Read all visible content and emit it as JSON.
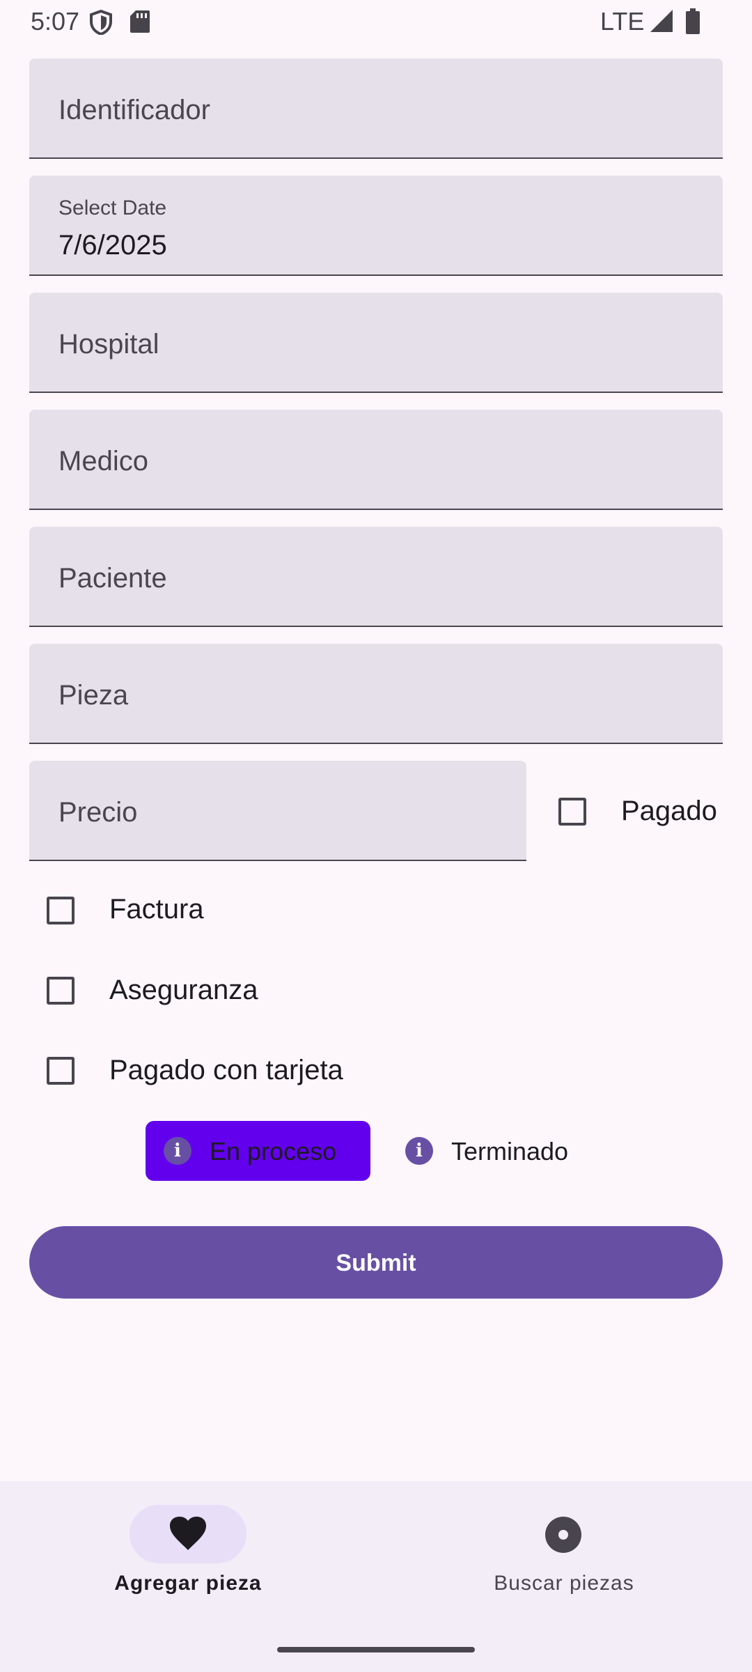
{
  "status_bar": {
    "time": "5:07",
    "network": "LTE",
    "icons": [
      "shield-icon",
      "sd-card-icon",
      "signal-icon",
      "battery-icon"
    ]
  },
  "form": {
    "identificador": {
      "placeholder": "Identificador"
    },
    "date": {
      "label": "Select Date",
      "value": "7/6/2025"
    },
    "hospital": {
      "placeholder": "Hospital"
    },
    "medico": {
      "placeholder": "Medico"
    },
    "paciente": {
      "placeholder": "Paciente"
    },
    "pieza": {
      "placeholder": "Pieza"
    },
    "precio": {
      "placeholder": "Precio"
    }
  },
  "checkboxes": {
    "pagado": {
      "label": "Pagado",
      "checked": false
    },
    "factura": {
      "label": "Factura",
      "checked": false
    },
    "aseguranza": {
      "label": "Aseguranza",
      "checked": false
    },
    "pagado_tarjeta": {
      "label": "Pagado con tarjeta",
      "checked": false
    }
  },
  "status_options": [
    {
      "label": "En proceso",
      "selected": true,
      "icon": "info-icon"
    },
    {
      "label": "Terminado",
      "selected": false,
      "icon": "info-icon"
    }
  ],
  "submit_label": "Submit",
  "bottom_nav": [
    {
      "label": "Agregar pieza",
      "icon": "heart-icon",
      "selected": true
    },
    {
      "label": "Buscar piezas",
      "icon": "disc-icon",
      "selected": false
    }
  ],
  "colors": {
    "primary": "#6750a4",
    "chip_active": "#6200ee",
    "field_bg": "#e6e0ea",
    "background": "#fdf7fc",
    "nav_bg": "#f3edf7",
    "nav_pill": "#e8def8"
  }
}
